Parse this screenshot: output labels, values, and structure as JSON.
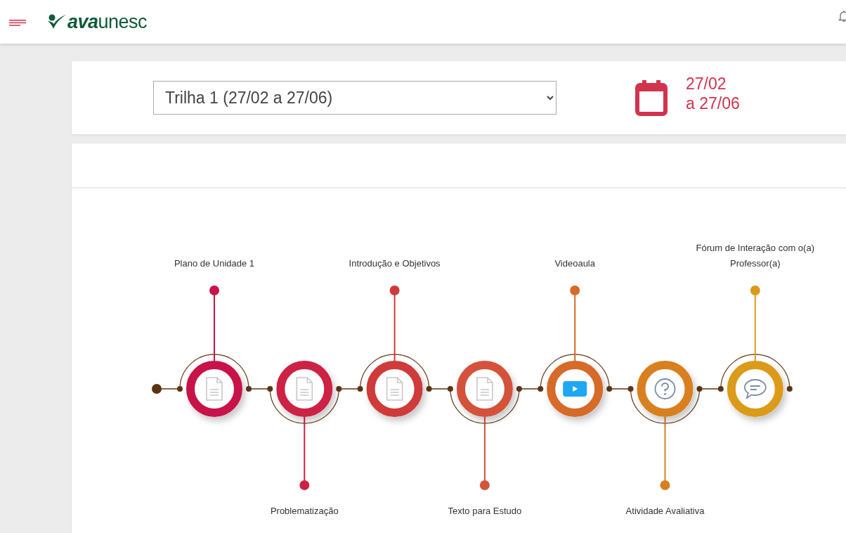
{
  "header": {
    "logo": "**ava**unesc"
  },
  "trail": {
    "value": "Trilha 1 (27/02 a 27/06)",
    "date_lines": [
      "27/02",
      "a 27/06"
    ]
  },
  "steps": [
    {
      "label": "Plano de Unidade 1",
      "kind": "document",
      "color": "#c8124a"
    },
    {
      "label": "Problematização",
      "kind": "document",
      "color": "#cc2244"
    },
    {
      "label": "Introdução e Objetivos",
      "kind": "document",
      "color": "#cf3a3a"
    },
    {
      "label": "Texto para Estudo",
      "kind": "document",
      "color": "#d4523a"
    },
    {
      "label": "Videoaula",
      "kind": "video",
      "color": "#d66a28"
    },
    {
      "label": "Atividade Avaliativa",
      "kind": "quiz",
      "color": "#d8801f"
    },
    {
      "label": "Fórum de Interação com o(a) Professor(a)",
      "kind": "forum",
      "color": "#dc9a1a"
    }
  ]
}
